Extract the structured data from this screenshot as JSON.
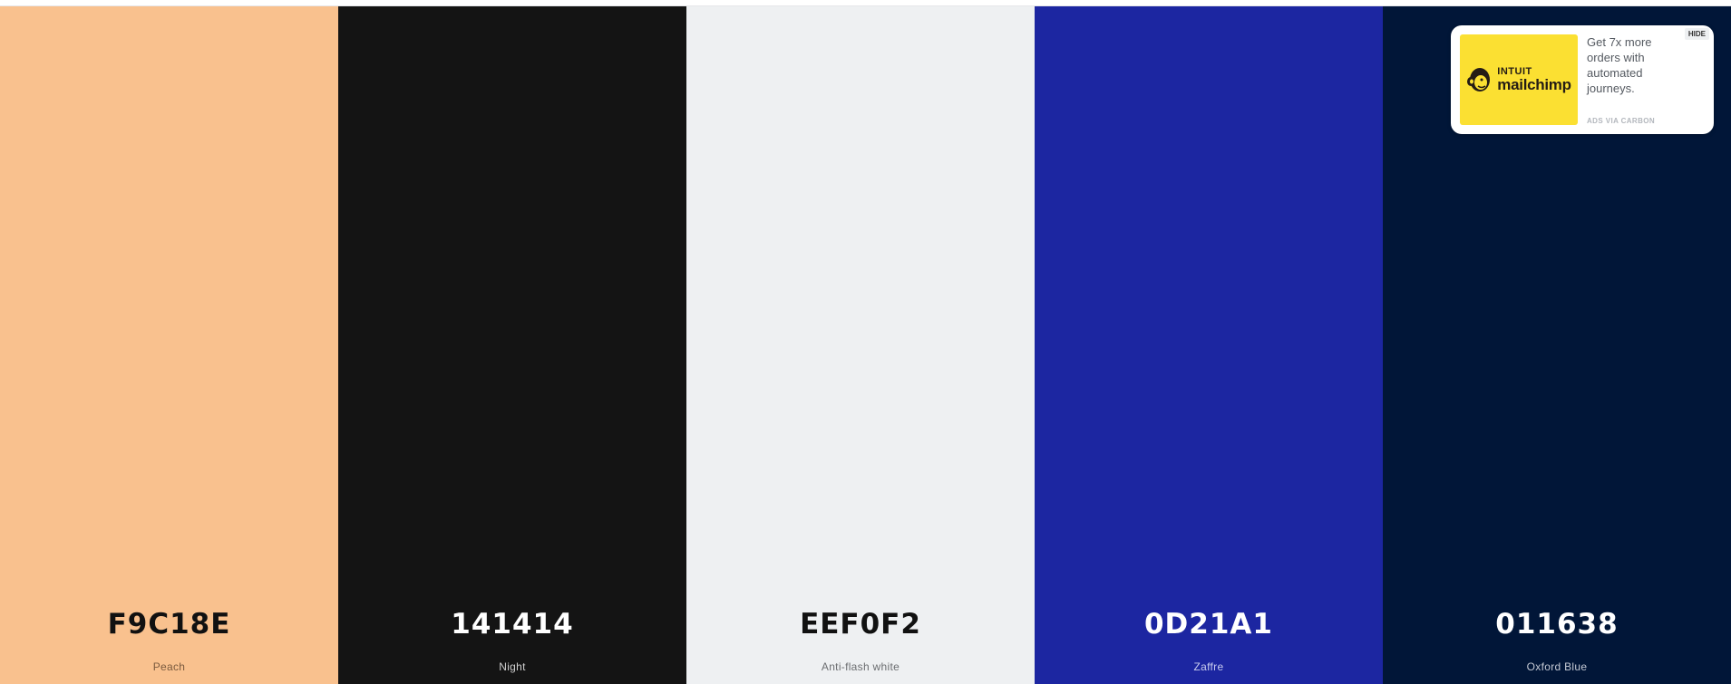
{
  "palette": {
    "colors": [
      {
        "hex": "F9C18E",
        "name": "Peach",
        "bg": "#F9C18E",
        "hex_color": "#111111",
        "name_color": "#7a5a3e"
      },
      {
        "hex": "141414",
        "name": "Night",
        "bg": "#141414",
        "hex_color": "#ffffff",
        "name_color": "#cfcfcf"
      },
      {
        "hex": "EEF0F2",
        "name": "Anti-flash white",
        "bg": "#EEF0F2",
        "hex_color": "#111111",
        "name_color": "#6c6e71"
      },
      {
        "hex": "0D21A1",
        "name": "Zaffre",
        "bg": "#1C26A1",
        "hex_color": "#ffffff",
        "name_color": "#c8ccee"
      },
      {
        "hex": "011638",
        "name": "Oxford Blue",
        "bg": "#011638",
        "hex_color": "#ffffff",
        "name_color": "#c4c9d4"
      }
    ]
  },
  "ad": {
    "brand_top": "INTUIT",
    "brand_bottom": "mailchimp",
    "image_bg": "#fbe032",
    "text": "Get 7x more orders with automated journeys.",
    "via": "ADS VIA CARBON",
    "hide_label": "HIDE"
  }
}
